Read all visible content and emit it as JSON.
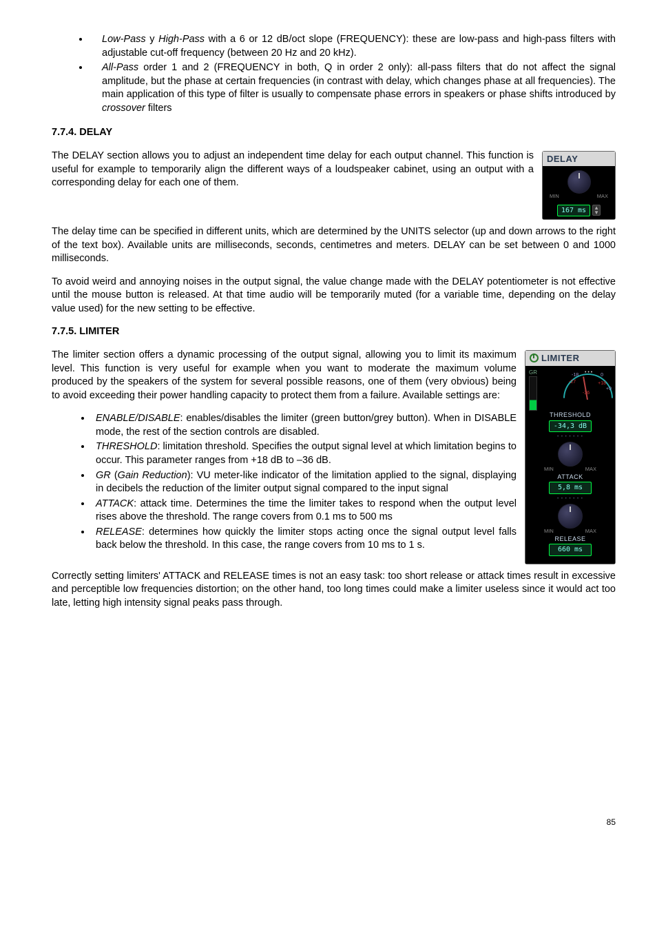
{
  "bullets_top": [
    {
      "name": "Low-Pass",
      "conj": " y ",
      "name2": "High-Pass",
      "rest": " with a 6 or 12 dB/oct slope (FREQUENCY): these are low-pass and high-pass filters with adjustable cut-off frequency (between 20 Hz and 20 kHz)."
    },
    {
      "name": "All-Pass",
      "rest": " order 1 and 2 (FREQUENCY in both, Q in order 2 only): all-pass filters that do not affect the signal amplitude, but the phase at certain frequencies (in contrast with delay, which changes phase at all frequencies). The main application of this type of filter is usually to compensate phase errors in speakers or phase shifts introduced by ",
      "tail_italic": "crossover",
      "tail": " filters"
    }
  ],
  "delay_heading": "7.7.4. DELAY",
  "delay_panel": {
    "title": "DELAY",
    "min": "MIN",
    "max": "MAX",
    "value": "167 ms"
  },
  "delay_p1": "The DELAY section allows you to adjust an independent time delay for each output channel. This function is useful for example to temporarily align the different ways of a loudspeaker cabinet, using an output with a corresponding delay for each one of them.",
  "delay_p2": "The delay time can be specified in different units, which are determined by the UNITS selector (up and down arrows to the right of the text box). Available units are milliseconds, seconds, centimetres and meters. DELAY can be set between 0 and 1000 milliseconds.",
  "delay_p3": "To avoid weird and annoying noises in the output signal, the value change made with the DELAY potentiometer is not effective until the mouse button is released. At that time audio will be temporarily muted (for a variable time, depending on the delay value used) for the new setting to be effective.",
  "limiter_heading": "7.7.5. LIMITER",
  "limiter_panel": {
    "title": "LIMITER",
    "gr": "GR",
    "ticks": {
      "m18": "-18",
      "m9": "-9",
      "zero": "0",
      "p9": "+9",
      "p18": "+18",
      "m27": "-27",
      "m36": "-36"
    },
    "threshold_label": "THRESHOLD",
    "threshold_value": "-34,3 dB",
    "min": "MIN",
    "max": "MAX",
    "attack_label": "ATTACK",
    "attack_value": "5,8 ms",
    "release_label": "RELEASE",
    "release_value": "660 ms"
  },
  "limiter_intro": "The limiter section offers a dynamic processing of the output signal, allowing you to limit its maximum level. This function is very useful for example when you want to moderate the maximum volume produced by the speakers of the system for several possible reasons, one of them (very obvious) being to avoid exceeding their power handling capacity to protect them from a failure. Available settings are:",
  "limiter_bullets": [
    {
      "name": "ENABLE/DISABLE",
      "rest": ": enables/disables the limiter (green button/grey button). When in DISABLE mode, the rest of the section controls are disabled."
    },
    {
      "name": "THRESHOLD",
      "rest": ": limitation threshold. Specifies the output signal level at which limitation begins to occur. This parameter ranges from +18 dB to  –36 dB."
    },
    {
      "name": "GR",
      "paren": "Gain Reduction",
      "rest": "): VU meter-like indicator of the limitation applied to the signal, displaying in decibels the reduction of the limiter output signal compared to the input signal"
    },
    {
      "name": "ATTACK",
      "rest": ": attack time. Determines the time the limiter takes to respond when the output level rises above the threshold. The range covers from 0.1 ms to 500 ms"
    },
    {
      "name": "RELEASE",
      "rest": ": determines how quickly the limiter stops acting once the signal output level falls back below the threshold. In this case, the range covers from 10 ms to 1 s."
    }
  ],
  "limiter_closing": "Correctly setting limiters' ATTACK and RELEASE times is not an easy task: too short release or attack times result in excessive and perceptible low frequencies distortion; on the other hand, too long times could make a limiter useless since it would act too late, letting high intensity signal peaks pass through.",
  "page_number": "85"
}
